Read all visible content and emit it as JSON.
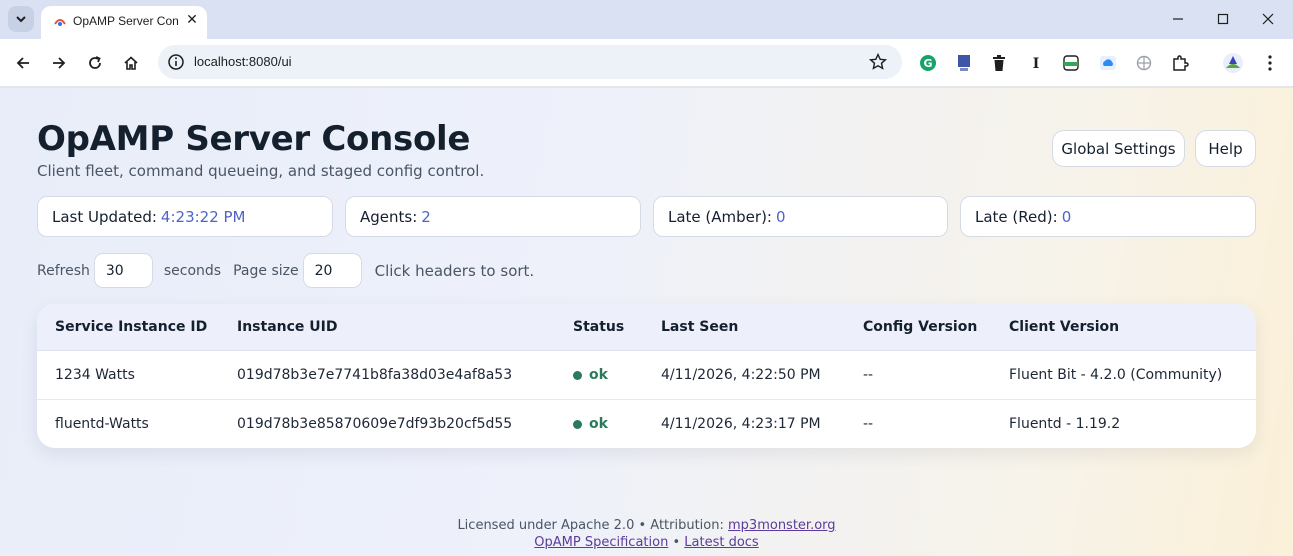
{
  "browser": {
    "tab_title": "OpAMP Server Con",
    "url": "localhost:8080/ui"
  },
  "header": {
    "title": "OpAMP Server Console",
    "subtitle": "Client fleet, command queueing, and staged config control.",
    "global_settings_label": "Global Settings",
    "help_label": "Help"
  },
  "stats": [
    {
      "label": "Last Updated:",
      "value": "4:23:22 PM"
    },
    {
      "label": "Agents:",
      "value": "2"
    },
    {
      "label": "Late (Amber):",
      "value": "0"
    },
    {
      "label": "Late (Red):",
      "value": "0"
    }
  ],
  "controls": {
    "refresh_label": "Refresh",
    "refresh_value": "30",
    "seconds_label": "seconds",
    "page_size_label": "Page size",
    "page_size_value": "20",
    "sort_hint": "Click headers to sort."
  },
  "table": {
    "columns": [
      "Service Instance ID",
      "Instance UID",
      "Status",
      "Last Seen",
      "Config Version",
      "Client Version"
    ],
    "rows": [
      {
        "service_id": "1234 Watts",
        "uid": "019d78b3e7e7741b8fa38d03e4af8a53",
        "status": "ok",
        "last_seen": "4/11/2026, 4:22:50 PM",
        "config_version": "--",
        "client_version": "Fluent Bit - 4.2.0 (Community)"
      },
      {
        "service_id": "fluentd-Watts",
        "uid": "019d78b3e85870609e7df93b20cf5d55",
        "status": "ok",
        "last_seen": "4/11/2026, 4:23:17 PM",
        "config_version": "--",
        "client_version": "Fluentd - 1.19.2"
      }
    ]
  },
  "footer": {
    "license_text": "Licensed under Apache 2.0 • Attribution:",
    "attribution_link": "mp3monster.org",
    "spec_link": "OpAMP Specification",
    "separator": "•",
    "docs_link": "Latest docs"
  },
  "colors": {
    "accent": "#4f63c9",
    "status_ok": "#2b7a5b",
    "link": "#5b3b9b"
  }
}
